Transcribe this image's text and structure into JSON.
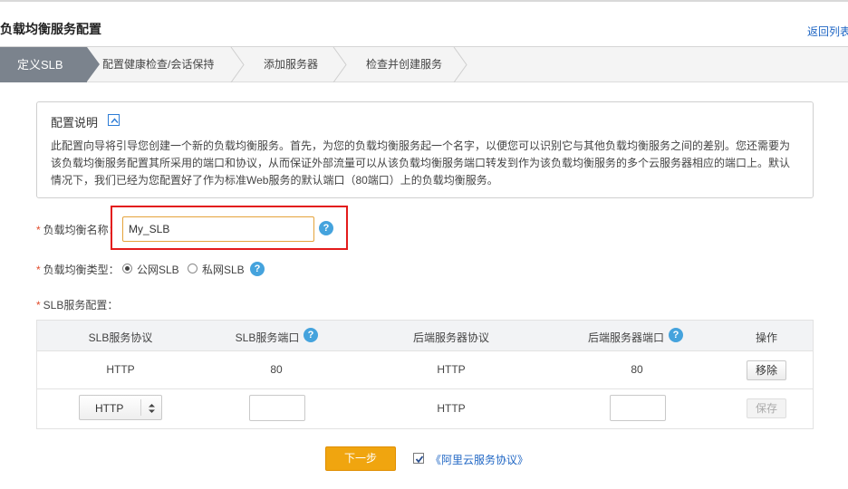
{
  "header": {
    "title": "负载均衡服务配置",
    "back_link": "返回列表"
  },
  "steps": [
    {
      "label": "定义SLB",
      "active": true
    },
    {
      "label": "配置健康检查/会话保持",
      "active": false
    },
    {
      "label": "添加服务器",
      "active": false
    },
    {
      "label": "检查并创建服务",
      "active": false
    }
  ],
  "description": {
    "title": "配置说明",
    "lines": [
      "此配置向导将引导您创建一个新的负载均衡服务。首先，为您的负载均衡服务起一个名字，以便您可以识别它与其他负载均衡服务之间的差别。您还需要为",
      "该负载均衡服务配置其所采用的端口和协议，从而保证外部流量可以从该负载均衡服务端口转发到作为该负载均衡服务的多个云服务器相应的端口上。默认",
      "情况下，我们已经为您配置好了作为标准Web服务的默认端口（80端口）上的负载均衡服务。"
    ]
  },
  "form": {
    "required_mark": "*",
    "name_label": "负载均衡名称：",
    "name_value": "My_SLB",
    "type_label": "负载均衡类型：",
    "type_public": "公网SLB",
    "type_private": "私网SLB",
    "type_selected": "公网SLB",
    "config_label": "SLB服务配置："
  },
  "help_glyph": "?",
  "table": {
    "headers": [
      "SLB服务协议",
      "SLB服务端口",
      "后端服务器协议",
      "后端服务器端口",
      "操作"
    ],
    "rows": [
      {
        "protocol": "HTTP",
        "port": "80",
        "backend_protocol": "HTTP",
        "backend_port": "80",
        "action": "移除"
      }
    ],
    "new_row": {
      "protocol": "HTTP",
      "backend_protocol": "HTTP",
      "action": "保存"
    }
  },
  "footer": {
    "next_label": "下一步",
    "agree_checked": true,
    "agree_link": "《阿里云服务协议》"
  },
  "colors": {
    "active_step": "#7b838d",
    "highlight_border": "#e31b1b",
    "next_button": "#f0a50f",
    "link": "#1f66c4",
    "help_icon": "#45a3dd"
  }
}
